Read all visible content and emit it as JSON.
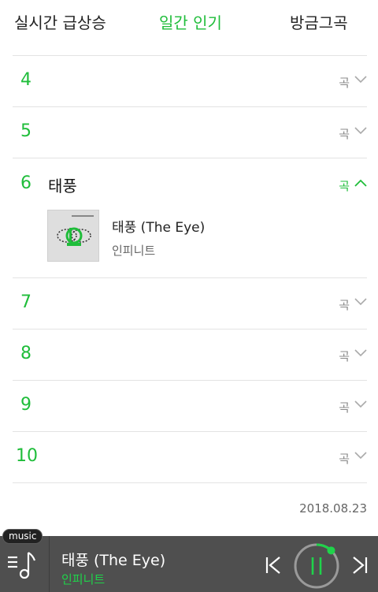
{
  "tabs": [
    {
      "label": "실시간 급상승",
      "active": false
    },
    {
      "label": "일간 인기",
      "active": true
    },
    {
      "label": "방금그곡",
      "active": false
    }
  ],
  "colors": {
    "accent": "#1fbd3a",
    "player_bg": "#4f4f4f",
    "divider": "#e3e3e3"
  },
  "chart_rows": [
    {
      "rank": "4",
      "kind": "곡"
    },
    {
      "rank": "5",
      "kind": "곡"
    }
  ],
  "expanded_row": {
    "rank": "6",
    "title": "태풍",
    "kind": "곡",
    "song": {
      "title": "태풍 (The Eye)",
      "artist": "인피니트"
    }
  },
  "chart_rows_after": [
    {
      "rank": "7",
      "kind": "곡"
    },
    {
      "rank": "8",
      "kind": "곡"
    },
    {
      "rank": "9",
      "kind": "곡"
    },
    {
      "rank": "10",
      "kind": "곡"
    }
  ],
  "date": "2018.08.23",
  "player": {
    "badge": "music",
    "title": "태풍 (The Eye)",
    "artist": "인피니트",
    "progress": 0.12,
    "icons": [
      "music-list-icon",
      "previous-icon",
      "pause-icon",
      "next-icon"
    ]
  }
}
